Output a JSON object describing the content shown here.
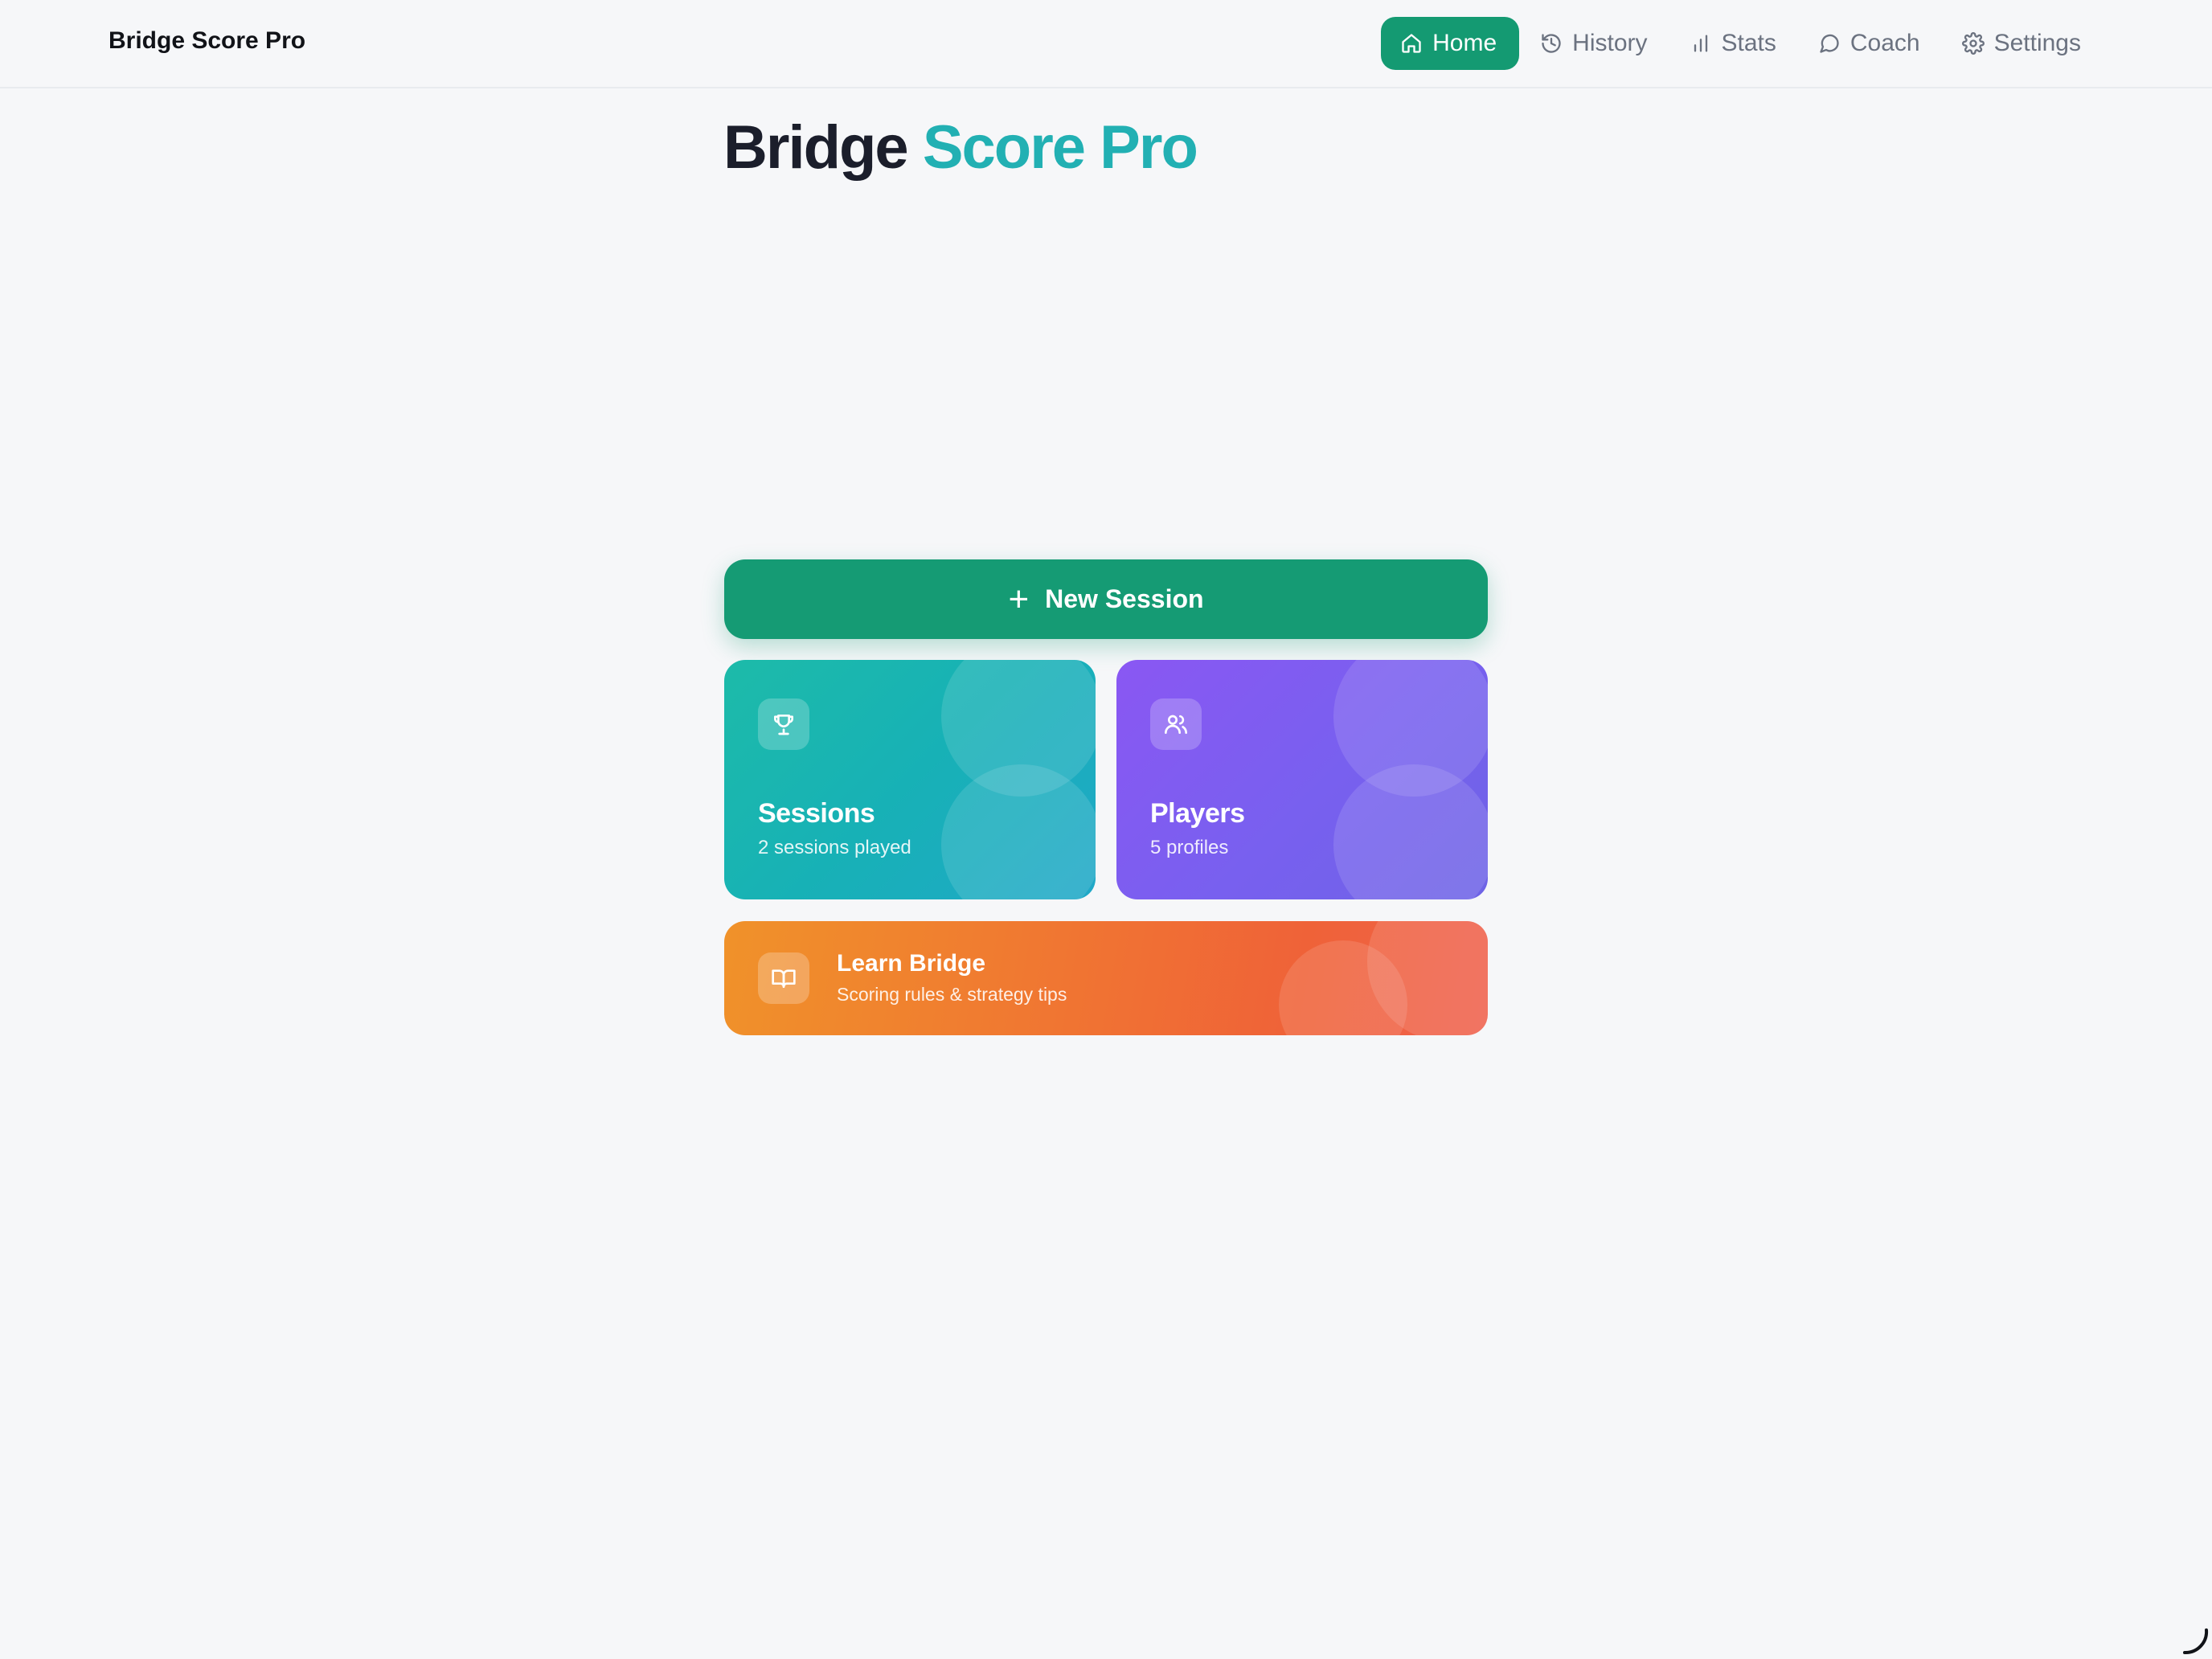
{
  "app": {
    "brand": "Bridge Score Pro"
  },
  "nav": {
    "items": [
      {
        "label": "Home",
        "icon": "home-icon",
        "active": true
      },
      {
        "label": "History",
        "icon": "history-icon",
        "active": false
      },
      {
        "label": "Stats",
        "icon": "bar-chart-icon",
        "active": false
      },
      {
        "label": "Coach",
        "icon": "chat-bubble-icon",
        "active": false
      },
      {
        "label": "Settings",
        "icon": "gear-icon",
        "active": false
      }
    ]
  },
  "hero": {
    "title_part1": "Bridge",
    "title_part2": "Score Pro"
  },
  "actions": {
    "new_session_label": "New Session"
  },
  "cards": {
    "sessions": {
      "title": "Sessions",
      "subtitle": "2 sessions played",
      "icon": "trophy-icon"
    },
    "players": {
      "title": "Players",
      "subtitle": "5 profiles",
      "icon": "users-icon"
    },
    "learn": {
      "title": "Learn Bridge",
      "subtitle": "Scoring rules & strategy tips",
      "icon": "book-icon"
    }
  },
  "colors": {
    "brand_green": "#159b74",
    "accent_teal": "#22b0b3",
    "sessions_gradient": [
      "#1dbba9",
      "#20a8c8"
    ],
    "players_gradient": [
      "#8a57f3",
      "#6e63e6"
    ],
    "learn_gradient": [
      "#f0922a",
      "#f0614e"
    ]
  }
}
